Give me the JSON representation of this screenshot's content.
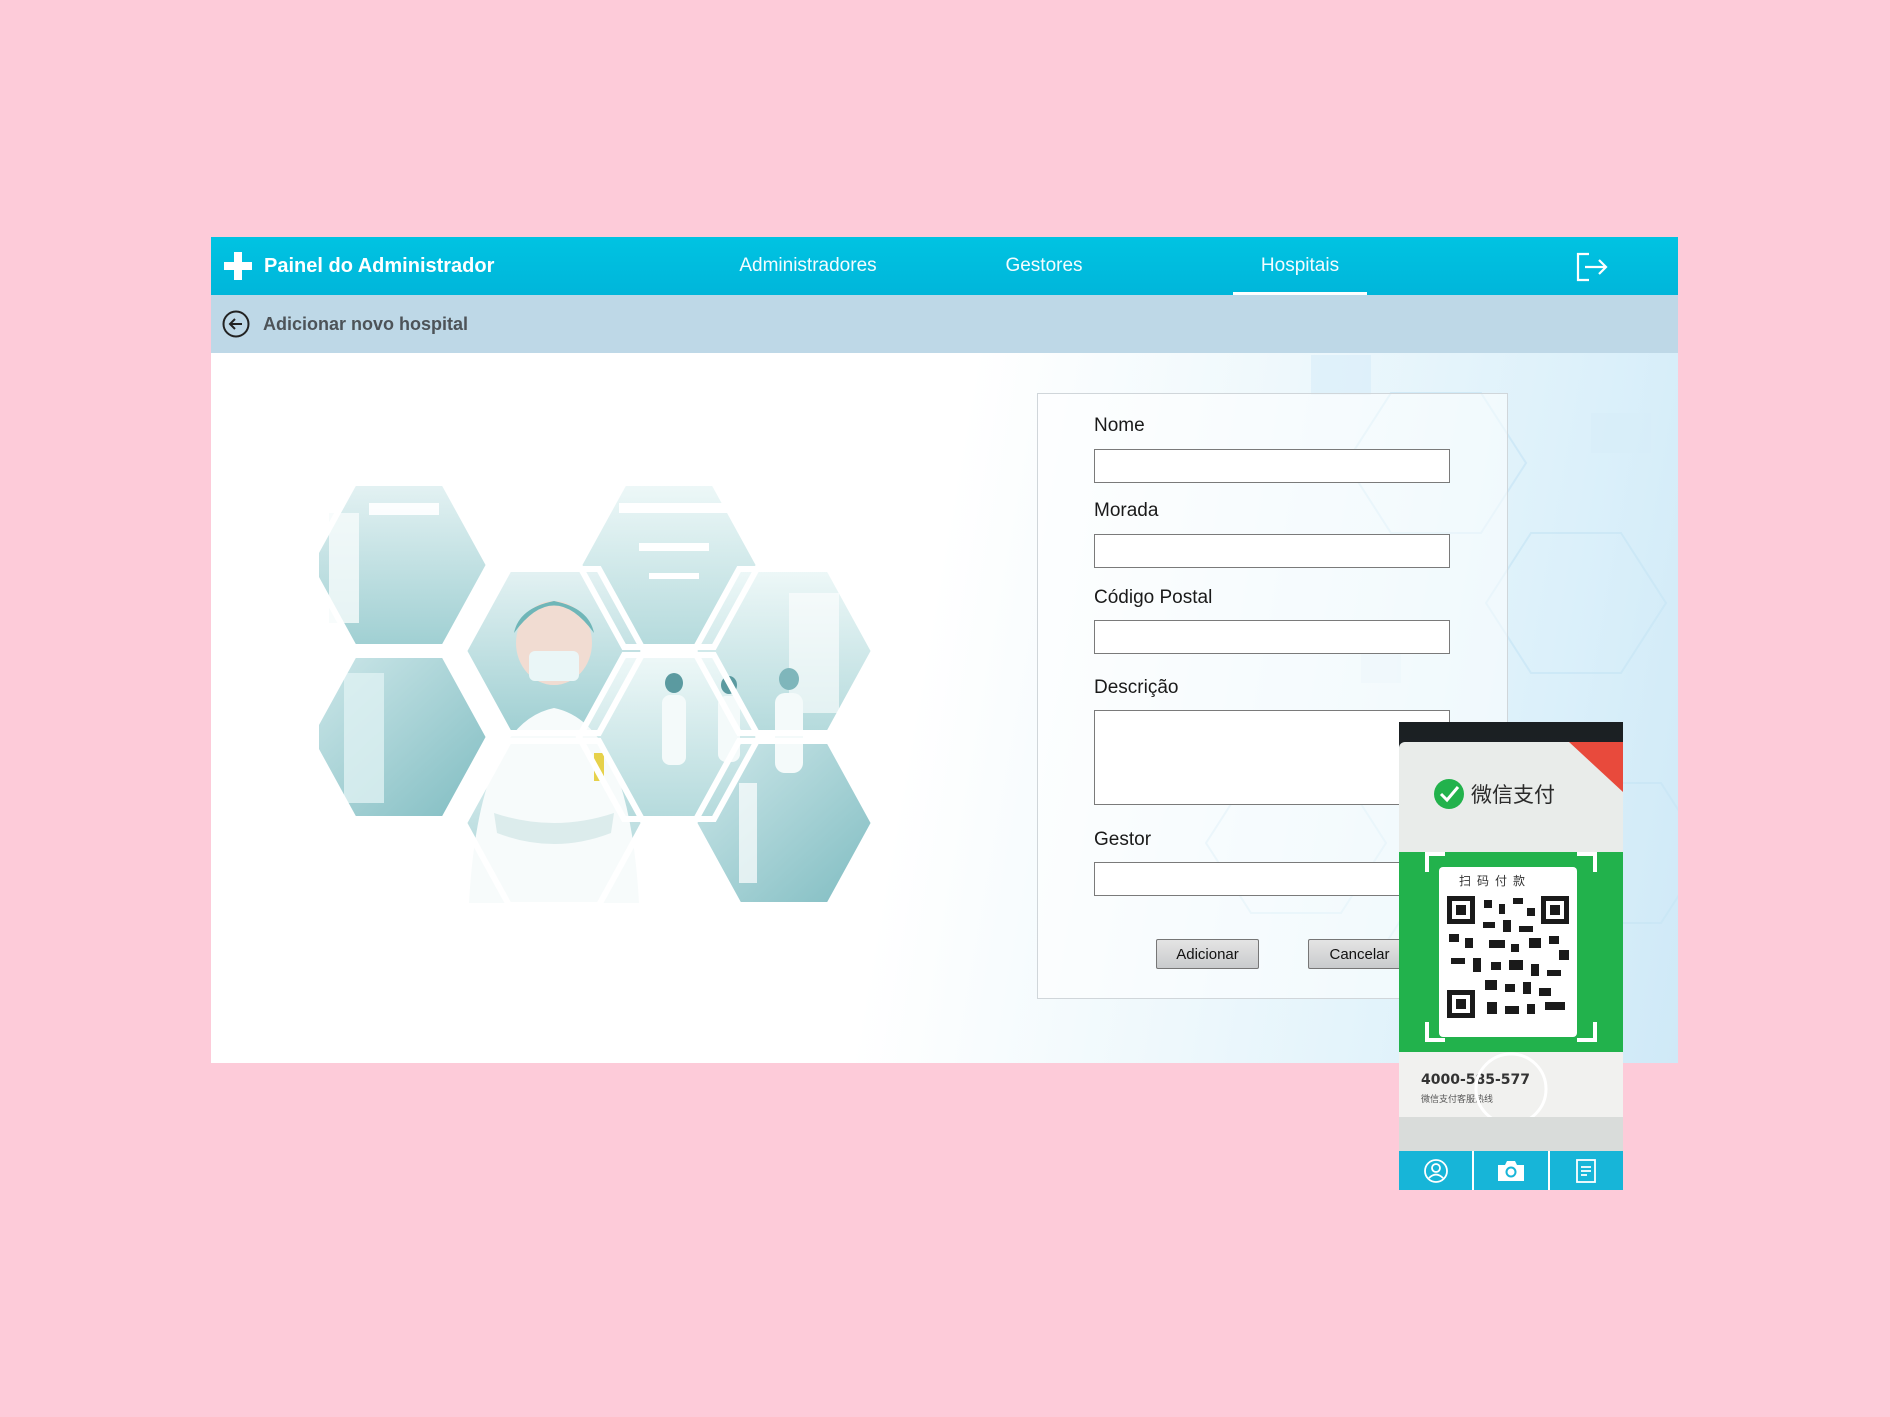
{
  "header": {
    "title": "Painel do Administrador",
    "tabs": [
      {
        "label": "Administradores",
        "active": false
      },
      {
        "label": "Gestores",
        "active": false
      },
      {
        "label": "Hospitais",
        "active": true
      }
    ]
  },
  "subheader": {
    "title": "Adicionar novo hospital"
  },
  "form": {
    "fields": [
      {
        "label": "Nome",
        "value": ""
      },
      {
        "label": "Morada",
        "value": ""
      },
      {
        "label": "Código Postal",
        "value": ""
      },
      {
        "label": "Descrição",
        "value": ""
      },
      {
        "label": "Gestor",
        "value": ""
      }
    ],
    "submit_label": "Adicionar",
    "cancel_label": "Cancelar"
  },
  "scanner": {
    "brand_text": "微信支付",
    "scan_text": "扫码付款",
    "phone_number": "4000-585-577",
    "hotline_label": "微信支付客服热线",
    "bottom_buttons": [
      "profile-icon",
      "camera-icon",
      "document-icon"
    ]
  },
  "colors": {
    "accent": "#00bddf",
    "subheader_bg": "#bed8e7",
    "page_bg": "#fdcbd9",
    "wechat_green": "#19a84a"
  }
}
